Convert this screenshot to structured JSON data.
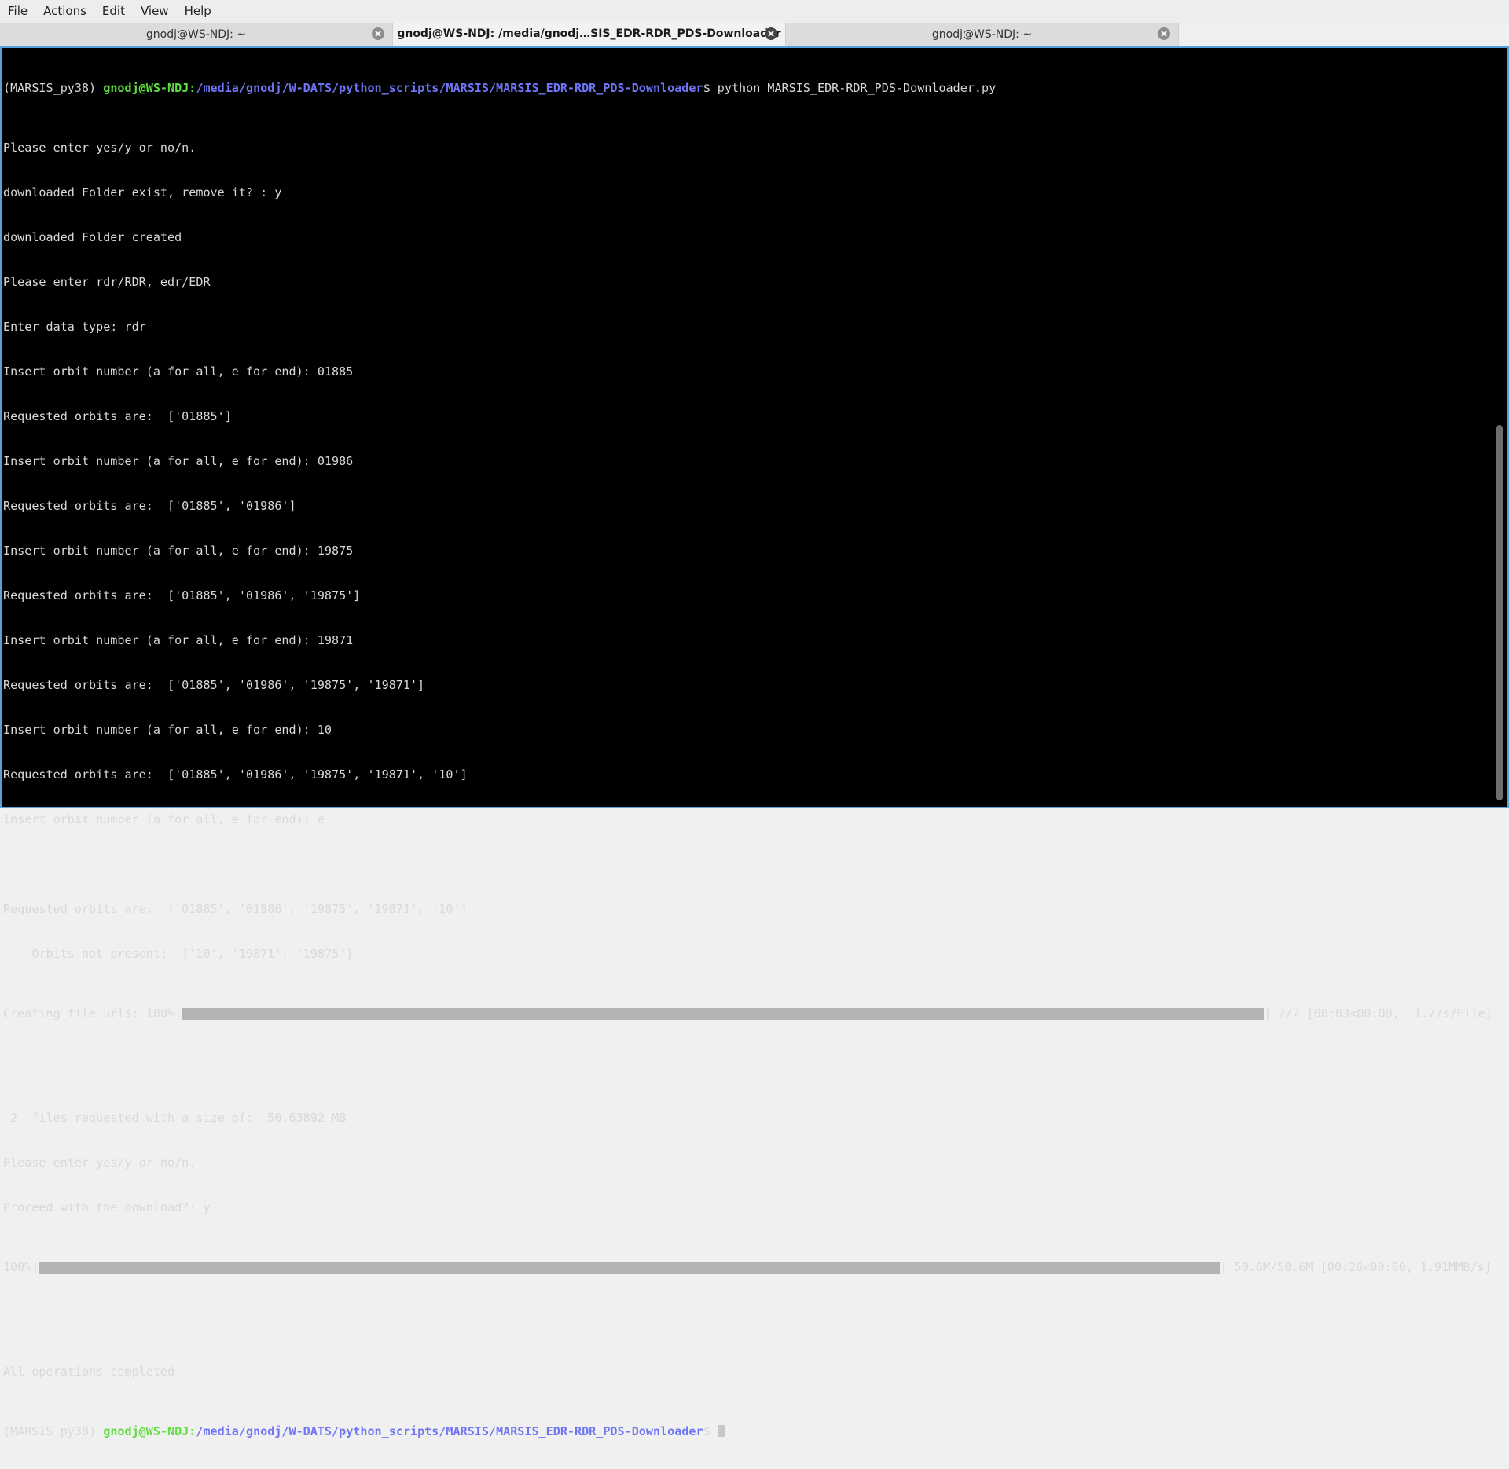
{
  "menu": [
    "File",
    "Actions",
    "Edit",
    "View",
    "Help"
  ],
  "tabs": [
    {
      "title": "gnodj@WS-NDJ: ~",
      "active": false
    },
    {
      "title": "gnodj@WS-NDJ: /media/gnodj…SIS_EDR-RDR_PDS-Downloader",
      "active": true
    },
    {
      "title": "gnodj@WS-NDJ: ~",
      "active": false
    }
  ],
  "prompt": {
    "env": "(MARSIS_py38) ",
    "user_host": "gnodj@WS-NDJ",
    "colon": ":",
    "path": "/media/gnodj/W-DATS/python_scripts/MARSIS/MARSIS_EDR-RDR_PDS-Downloader",
    "dollar": "$ "
  },
  "command": "python MARSIS_EDR-RDR_PDS-Downloader.py",
  "output_lines": [
    "Please enter yes/y or no/n.",
    "downloaded Folder exist, remove it? : y",
    "downloaded Folder created",
    "Please enter rdr/RDR, edr/EDR",
    "Enter data type: rdr",
    "Insert orbit number (a for all, e for end): 01885",
    "Requested orbits are:  ['01885']",
    "Insert orbit number (a for all, e for end): 01986",
    "Requested orbits are:  ['01885', '01986']",
    "Insert orbit number (a for all, e for end): 19875",
    "Requested orbits are:  ['01885', '01986', '19875']",
    "Insert orbit number (a for all, e for end): 19871",
    "Requested orbits are:  ['01885', '01986', '19875', '19871']",
    "Insert orbit number (a for all, e for end): 10",
    "Requested orbits are:  ['01885', '01986', '19875', '19871', '10']",
    "Insert orbit number (a for all, e for end): e",
    "",
    "Requested orbits are:  ['01885', '01986', '19875', '19871', '10']",
    "    Orbits not present:  ['10', '19871', '19875']"
  ],
  "progress1": {
    "prefix": "Creating file urls: 100%|",
    "suffix": "| 2/2 [00:03<00:00,  1.77s/File]",
    "percent": 100
  },
  "middle_lines": [
    "",
    " 2  files requested with a size of:  50.63892 MB",
    "Please enter yes/y or no/n.",
    "Proceed with the download?: y"
  ],
  "progress2": {
    "prefix": "100%|",
    "suffix": "| 50.6M/50.6M [00:26<00:00, 1.91MMB/s]",
    "percent": 100
  },
  "end_lines": [
    "",
    "All operations completed"
  ],
  "colors": {
    "user": "#5fdf3f",
    "path": "#6f76f5",
    "background": "#000000",
    "text": "#d9d9d9",
    "accent_border": "#5aa0d6"
  }
}
